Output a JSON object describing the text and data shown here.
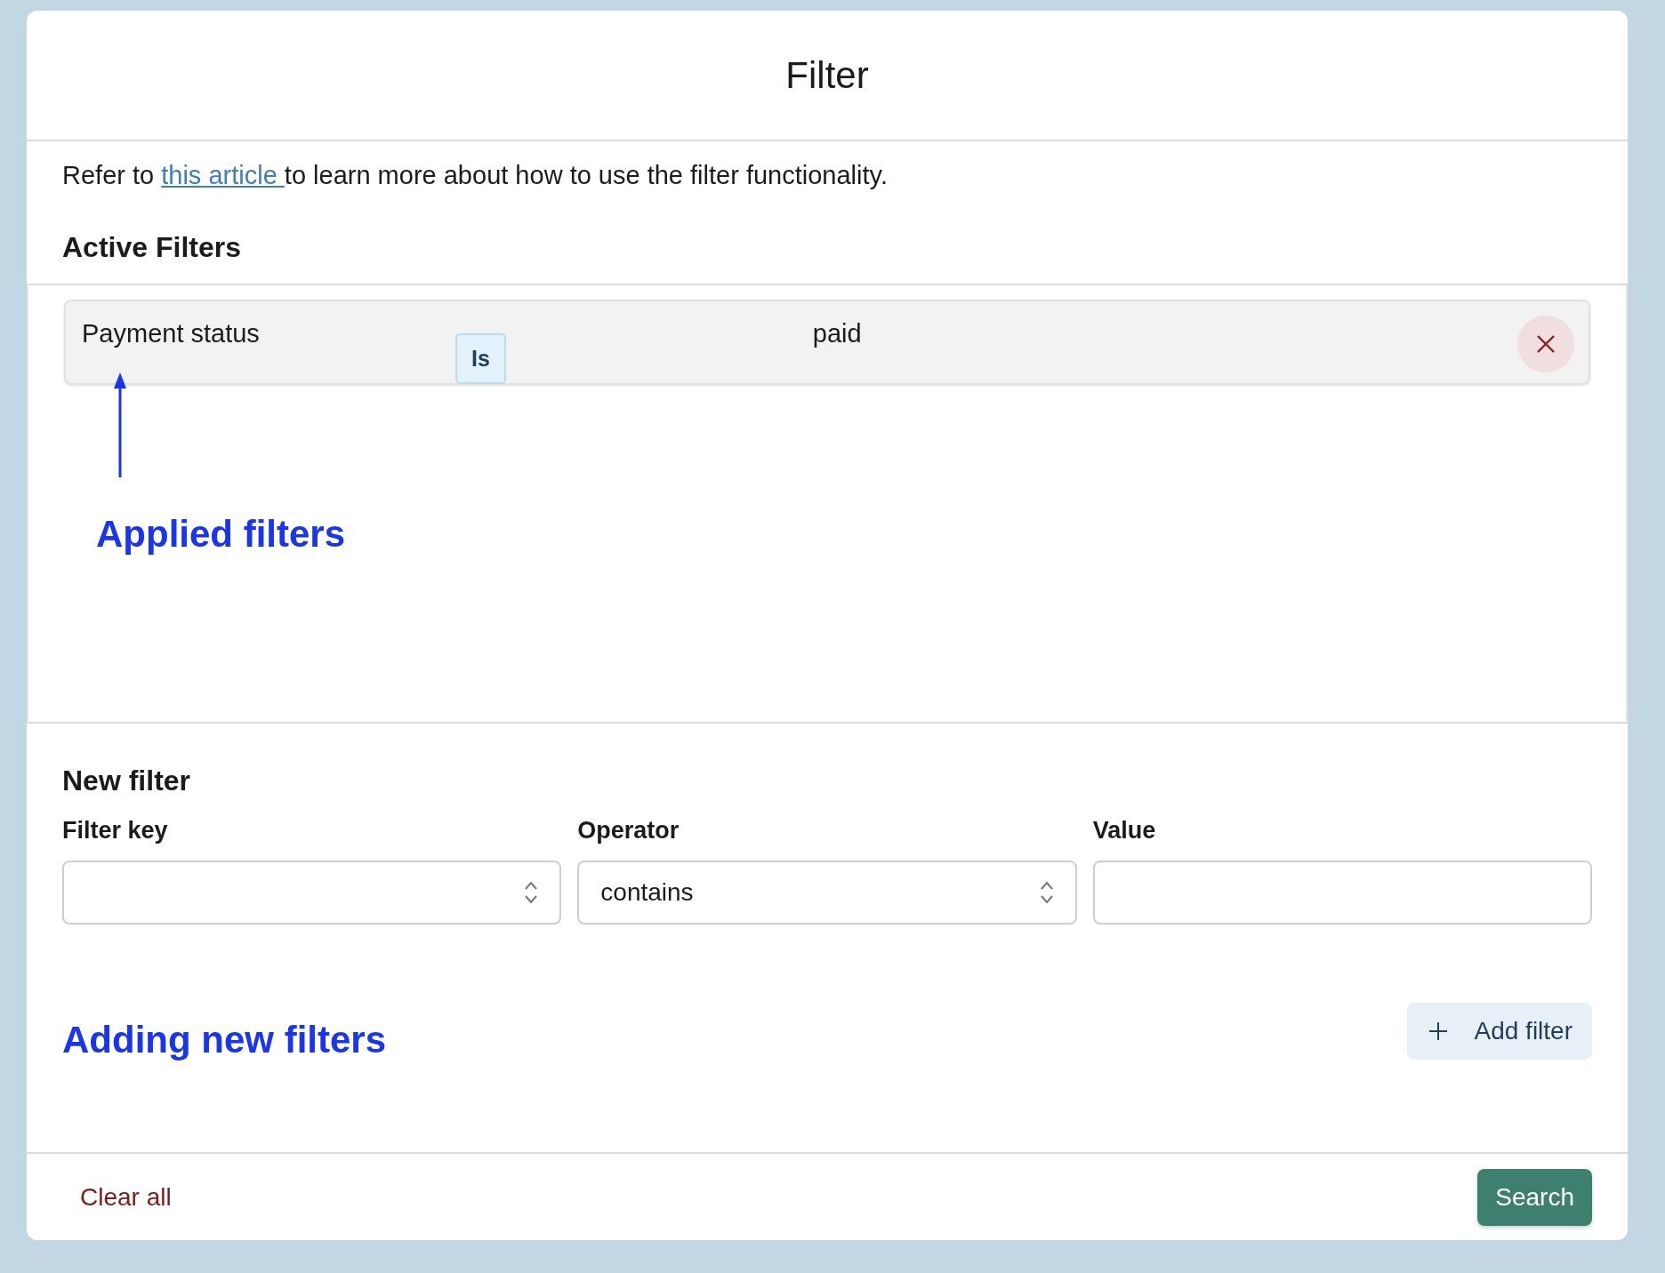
{
  "dialog": {
    "title": "Filter",
    "intro": {
      "before": "Refer to ",
      "link": "this article ",
      "after": "to learn more about how to use the filter functionality."
    },
    "active_filters": {
      "heading": "Active Filters",
      "filters": [
        {
          "key": "Payment status",
          "operator": "Is",
          "value": "paid"
        }
      ],
      "annotation": "Applied filters"
    },
    "new_filter": {
      "heading": "New filter",
      "fields": [
        {
          "kind": "select",
          "label": "Filter key"
        },
        {
          "kind": "select",
          "label": "Operator",
          "value": "contains"
        },
        {
          "kind": "text",
          "label": "Value"
        }
      ],
      "annotation": "Adding new filters",
      "add_button": "Add filter"
    },
    "footer": {
      "clear": "Clear all",
      "search": "Search"
    }
  }
}
